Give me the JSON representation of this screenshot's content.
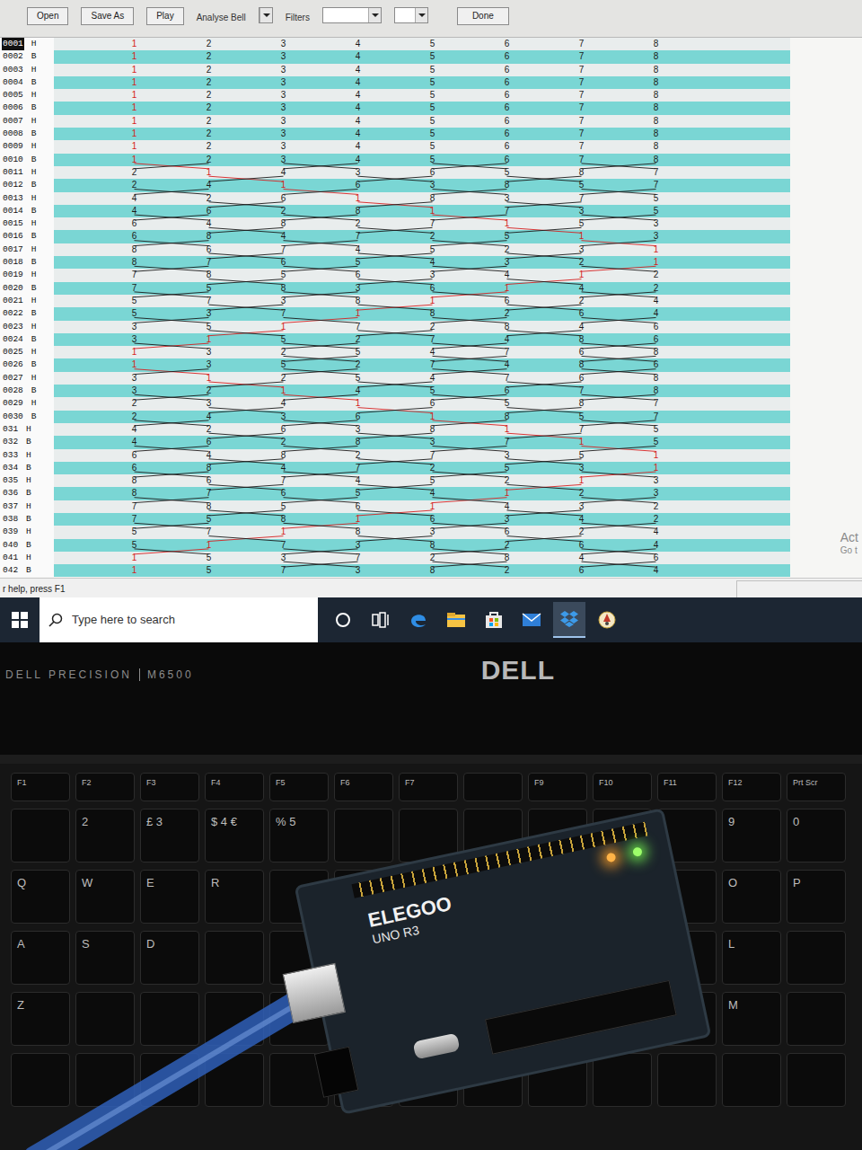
{
  "toolbar": {
    "buttons": [
      {
        "label": "Open"
      },
      {
        "label": "Save As"
      },
      {
        "label": "Play"
      }
    ],
    "analyse_label": "Analyse Bell",
    "filters_label": "Filters",
    "done_label": "Done"
  },
  "ringing": {
    "bells": [
      {
        "label": "1",
        "color": "#d62020"
      },
      {
        "label": "2",
        "color": "#1a1a1a"
      },
      {
        "label": "3",
        "color": "#1a1a1a"
      },
      {
        "label": "4",
        "color": "#1a1a1a"
      },
      {
        "label": "5",
        "color": "#1a1a1a"
      },
      {
        "label": "6",
        "color": "#1a1a1a"
      },
      {
        "label": "7",
        "color": "#1a1a1a"
      },
      {
        "label": "8",
        "color": "#1a1a1a"
      }
    ],
    "rows": [
      {
        "number": "0001",
        "stroke": "H",
        "selected": true,
        "places": [
          "1",
          "2",
          "3",
          "4",
          "5",
          "6",
          "7",
          "8"
        ]
      },
      {
        "number": "0002",
        "stroke": "B",
        "selected": false,
        "places": [
          "1",
          "2",
          "3",
          "4",
          "5",
          "6",
          "7",
          "8"
        ]
      },
      {
        "number": "0003",
        "stroke": "H",
        "selected": false,
        "places": [
          "1",
          "2",
          "3",
          "4",
          "5",
          "6",
          "7",
          "8"
        ]
      },
      {
        "number": "0004",
        "stroke": "B",
        "selected": false,
        "places": [
          "1",
          "2",
          "3",
          "4",
          "5",
          "6",
          "7",
          "8"
        ]
      },
      {
        "number": "0005",
        "stroke": "H",
        "selected": false,
        "places": [
          "1",
          "2",
          "3",
          "4",
          "5",
          "6",
          "7",
          "8"
        ]
      },
      {
        "number": "0006",
        "stroke": "B",
        "selected": false,
        "places": [
          "1",
          "2",
          "3",
          "4",
          "5",
          "6",
          "7",
          "8"
        ]
      },
      {
        "number": "0007",
        "stroke": "H",
        "selected": false,
        "places": [
          "1",
          "2",
          "3",
          "4",
          "5",
          "6",
          "7",
          "8"
        ]
      },
      {
        "number": "0008",
        "stroke": "B",
        "selected": false,
        "places": [
          "1",
          "2",
          "3",
          "4",
          "5",
          "6",
          "7",
          "8"
        ]
      },
      {
        "number": "0009",
        "stroke": "H",
        "selected": false,
        "places": [
          "1",
          "2",
          "3",
          "4",
          "5",
          "6",
          "7",
          "8"
        ]
      },
      {
        "number": "0010",
        "stroke": "B",
        "selected": false,
        "places": [
          "1",
          "2",
          "3",
          "4",
          "5",
          "6",
          "7",
          "8"
        ]
      },
      {
        "number": "0011",
        "stroke": "H",
        "selected": false,
        "places": [
          "2",
          "1",
          "4",
          "3",
          "6",
          "5",
          "8",
          "7"
        ]
      },
      {
        "number": "0012",
        "stroke": "B",
        "selected": false,
        "places": [
          "2",
          "4",
          "1",
          "6",
          "3",
          "8",
          "5",
          "7"
        ]
      },
      {
        "number": "0013",
        "stroke": "H",
        "selected": false,
        "places": [
          "4",
          "2",
          "6",
          "1",
          "8",
          "3",
          "7",
          "5"
        ]
      },
      {
        "number": "0014",
        "stroke": "B",
        "selected": false,
        "places": [
          "4",
          "6",
          "2",
          "8",
          "1",
          "7",
          "3",
          "5"
        ]
      },
      {
        "number": "0015",
        "stroke": "H",
        "selected": false,
        "places": [
          "6",
          "4",
          "8",
          "2",
          "7",
          "1",
          "5",
          "3"
        ]
      },
      {
        "number": "0016",
        "stroke": "B",
        "selected": false,
        "places": [
          "6",
          "8",
          "4",
          "7",
          "2",
          "5",
          "1",
          "3"
        ]
      },
      {
        "number": "0017",
        "stroke": "H",
        "selected": false,
        "places": [
          "8",
          "6",
          "7",
          "4",
          "5",
          "2",
          "3",
          "1"
        ]
      },
      {
        "number": "0018",
        "stroke": "B",
        "selected": false,
        "places": [
          "8",
          "7",
          "6",
          "5",
          "4",
          "3",
          "2",
          "1"
        ]
      },
      {
        "number": "0019",
        "stroke": "H",
        "selected": false,
        "places": [
          "7",
          "8",
          "5",
          "6",
          "3",
          "4",
          "1",
          "2"
        ]
      },
      {
        "number": "0020",
        "stroke": "B",
        "selected": false,
        "places": [
          "7",
          "5",
          "8",
          "3",
          "6",
          "1",
          "4",
          "2"
        ]
      },
      {
        "number": "0021",
        "stroke": "H",
        "selected": false,
        "places": [
          "5",
          "7",
          "3",
          "8",
          "1",
          "6",
          "2",
          "4"
        ]
      },
      {
        "number": "0022",
        "stroke": "B",
        "selected": false,
        "places": [
          "5",
          "3",
          "7",
          "1",
          "8",
          "2",
          "6",
          "4"
        ]
      },
      {
        "number": "0023",
        "stroke": "H",
        "selected": false,
        "places": [
          "3",
          "5",
          "1",
          "7",
          "2",
          "8",
          "4",
          "6"
        ]
      },
      {
        "number": "0024",
        "stroke": "B",
        "selected": false,
        "places": [
          "3",
          "1",
          "5",
          "2",
          "7",
          "4",
          "8",
          "6"
        ]
      },
      {
        "number": "0025",
        "stroke": "H",
        "selected": false,
        "places": [
          "1",
          "3",
          "2",
          "5",
          "4",
          "7",
          "6",
          "8"
        ]
      },
      {
        "number": "0026",
        "stroke": "B",
        "selected": false,
        "places": [
          "1",
          "3",
          "5",
          "2",
          "7",
          "4",
          "8",
          "6"
        ]
      },
      {
        "number": "0027",
        "stroke": "H",
        "selected": false,
        "places": [
          "3",
          "1",
          "2",
          "5",
          "4",
          "7",
          "6",
          "8"
        ]
      },
      {
        "number": "0028",
        "stroke": "B",
        "selected": false,
        "places": [
          "3",
          "2",
          "1",
          "4",
          "5",
          "6",
          "7",
          "8"
        ]
      },
      {
        "number": "0029",
        "stroke": "H",
        "selected": false,
        "places": [
          "2",
          "3",
          "4",
          "1",
          "6",
          "5",
          "8",
          "7"
        ]
      },
      {
        "number": "0030",
        "stroke": "B",
        "selected": false,
        "places": [
          "2",
          "4",
          "3",
          "6",
          "1",
          "8",
          "5",
          "7"
        ]
      },
      {
        "number": "031",
        "stroke": "H",
        "selected": false,
        "places": [
          "4",
          "2",
          "6",
          "3",
          "8",
          "1",
          "7",
          "5"
        ]
      },
      {
        "number": "032",
        "stroke": "B",
        "selected": false,
        "places": [
          "4",
          "6",
          "2",
          "8",
          "3",
          "7",
          "1",
          "5"
        ]
      },
      {
        "number": "033",
        "stroke": "H",
        "selected": false,
        "places": [
          "6",
          "4",
          "8",
          "2",
          "7",
          "3",
          "5",
          "1"
        ]
      },
      {
        "number": "034",
        "stroke": "B",
        "selected": false,
        "places": [
          "6",
          "8",
          "4",
          "7",
          "2",
          "5",
          "3",
          "1"
        ]
      },
      {
        "number": "035",
        "stroke": "H",
        "selected": false,
        "places": [
          "8",
          "6",
          "7",
          "4",
          "5",
          "2",
          "1",
          "3"
        ]
      },
      {
        "number": "036",
        "stroke": "B",
        "selected": false,
        "places": [
          "8",
          "7",
          "6",
          "5",
          "4",
          "1",
          "2",
          "3"
        ]
      },
      {
        "number": "037",
        "stroke": "H",
        "selected": false,
        "places": [
          "7",
          "8",
          "5",
          "6",
          "1",
          "4",
          "3",
          "2"
        ]
      },
      {
        "number": "038",
        "stroke": "B",
        "selected": false,
        "places": [
          "7",
          "5",
          "8",
          "1",
          "6",
          "3",
          "4",
          "2"
        ]
      },
      {
        "number": "039",
        "stroke": "H",
        "selected": false,
        "places": [
          "5",
          "7",
          "1",
          "8",
          "3",
          "6",
          "2",
          "4"
        ]
      },
      {
        "number": "040",
        "stroke": "B",
        "selected": false,
        "places": [
          "5",
          "1",
          "7",
          "3",
          "8",
          "2",
          "6",
          "4"
        ]
      },
      {
        "number": "041",
        "stroke": "H",
        "selected": false,
        "places": [
          "1",
          "5",
          "3",
          "7",
          "2",
          "8",
          "4",
          "6"
        ]
      },
      {
        "number": "042",
        "stroke": "B",
        "selected": false,
        "places": [
          "1",
          "5",
          "7",
          "3",
          "8",
          "2",
          "6",
          "4"
        ]
      }
    ]
  },
  "watermark": {
    "line1": "Act",
    "line2": "Go t"
  },
  "status_bar": {
    "text": "r help, press F1"
  },
  "taskbar": {
    "search_placeholder": "Type here to search"
  },
  "laptop": {
    "series": "DELL PRECISION",
    "model": "M6500",
    "logo": "DELL"
  },
  "keyboard": {
    "rows": [
      [
        "F1",
        "F2",
        "F3",
        "F4",
        "F5",
        "F6",
        "F7",
        "",
        "F9",
        "F10",
        "F11",
        "F12",
        "Prt Scr"
      ],
      [
        "",
        "2",
        "£ 3",
        "$ 4 €",
        "% 5",
        "",
        "",
        "",
        "",
        "",
        "",
        "9",
        "0"
      ],
      [
        "Q",
        "W",
        "E",
        "R",
        "",
        "",
        "",
        "",
        "",
        "",
        "",
        "O",
        "P"
      ],
      [
        "A",
        "S",
        "D",
        "",
        "",
        "",
        "",
        "",
        "",
        "",
        "",
        "L",
        ""
      ],
      [
        "Z",
        "",
        "",
        "",
        "",
        "",
        "",
        "",
        "",
        "",
        "",
        "M",
        ""
      ],
      [
        "",
        "",
        "",
        "",
        "",
        "",
        "",
        "",
        "",
        "",
        "",
        "",
        ""
      ]
    ]
  },
  "board": {
    "brand": "ELEGOO",
    "model": "UNO R3"
  }
}
